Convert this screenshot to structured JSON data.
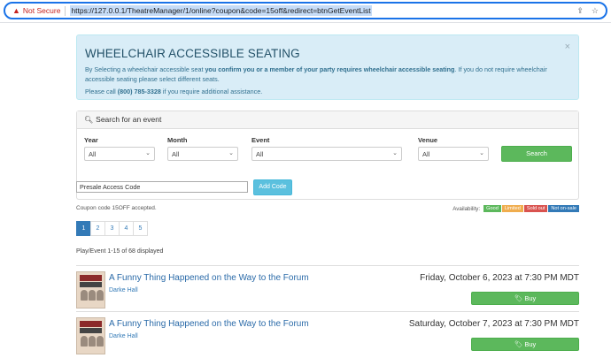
{
  "browser": {
    "security_label": "Not Secure",
    "url": "https://127.0.0.1/TheatreManager/1/online?coupon&code=15off&redirect=btnGetEventList"
  },
  "alert": {
    "title": "WHEELCHAIR ACCESSIBLE SEATING",
    "line1_pre": "By Selecting a wheelchair accessible seat ",
    "line1_bold": "you confirm you or a member of your party requires wheelchair accessible seating",
    "line1_post": ". If you do not require wheelchair accessible seating please select different seats.",
    "line2_pre": "Please call ",
    "phone": "(800) 785-3328",
    "line2_post": " if you require additional assistance.",
    "close": "×"
  },
  "search": {
    "heading": "Search for an event",
    "filters": [
      {
        "label": "Year",
        "value": "All"
      },
      {
        "label": "Month",
        "value": "All"
      },
      {
        "label": "Event",
        "value": "All"
      },
      {
        "label": "Venue",
        "value": "All"
      }
    ],
    "button": "Search"
  },
  "presale": {
    "placeholder": "Presale Access Code",
    "button": "Add Code"
  },
  "coupon_message": "Coupon code 15OFF accepted.",
  "availability": {
    "label": "Availability:",
    "chips": [
      {
        "label": "Good",
        "color": "#5cb85c"
      },
      {
        "label": "Limited",
        "color": "#f0ad4e"
      },
      {
        "label": "Sold out",
        "color": "#d9534f"
      },
      {
        "label": "Not on-sale",
        "color": "#337ab7"
      }
    ]
  },
  "pagination": [
    "1",
    "2",
    "3",
    "4",
    "5"
  ],
  "results_count": "Play/Event 1-15 of 68 displayed",
  "events": [
    {
      "title": "A Funny Thing Happened on the Way to the Forum",
      "venue": "Darke Hall",
      "date": "Friday, October 6, 2023 at 7:30 PM MDT",
      "buy": "🏷 Buy"
    },
    {
      "title": "A Funny Thing Happened on the Way to the Forum",
      "venue": "Darke Hall",
      "date": "Saturday, October 7, 2023 at 7:30 PM MDT",
      "buy": "🏷 Buy"
    }
  ]
}
